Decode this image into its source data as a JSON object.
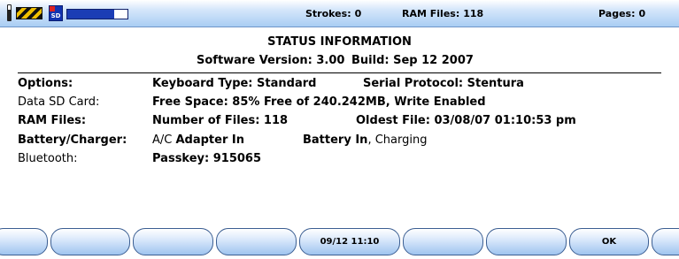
{
  "status_bar": {
    "strokes_label": "Strokes:",
    "strokes_value": "0",
    "ram_files_label": "RAM Files:",
    "ram_files_value": "118",
    "pages_label": "Pages:",
    "pages_value": "0",
    "memory_level_fraction": 0.78,
    "icons": [
      "battery-icon",
      "caution-stripe-icon",
      "sd-card-icon"
    ]
  },
  "status_info": {
    "title": "STATUS INFORMATION",
    "software_version": "Software Version: 3.00",
    "build": "Build: Sep 12 2007",
    "rows": {
      "options": {
        "label": "Options:",
        "keyboard_type": "Keyboard Type: Standard",
        "serial_protocol": "Serial Protocol: Stentura"
      },
      "data_sd_card": {
        "label": "Data SD Card:",
        "free_space": "Free Space: 85% Free of 240.242MB, Write Enabled"
      },
      "ram_files": {
        "label": "RAM Files:",
        "number_of_files": "Number of Files: 118",
        "oldest_file": "Oldest File: 03/08/07  01:10:53 pm"
      },
      "battery_charger": {
        "label": "Battery/Charger:",
        "adapter_label": "A/C ",
        "adapter_bold": "Adapter In",
        "battery_bold": "Battery In",
        "battery_status": ", Charging"
      },
      "bluetooth": {
        "label": "Bluetooth:",
        "passkey": "Passkey: 915065"
      }
    }
  },
  "softkeys": [
    "",
    "",
    "",
    "",
    "09/12  11:10",
    "",
    "",
    "OK",
    ""
  ],
  "colors": {
    "bar_top": "#ffffff",
    "bar_bottom": "#a9cdf3",
    "memory_fill": "#1b3db5",
    "key_border": "#3b5e92"
  }
}
